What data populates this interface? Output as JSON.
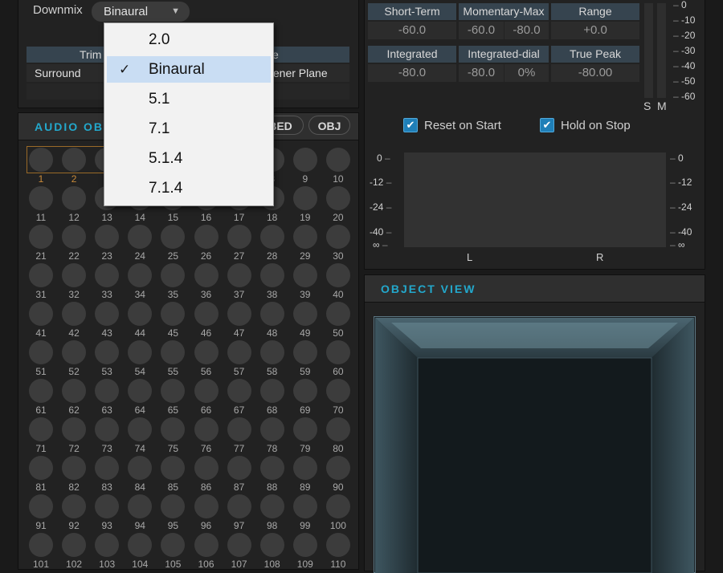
{
  "downmix": {
    "label": "Downmix",
    "selected": "Binaural",
    "options": [
      {
        "label": "2.0",
        "selected": false
      },
      {
        "label": "Binaural",
        "selected": true
      },
      {
        "label": "5.1",
        "selected": false
      },
      {
        "label": "7.1",
        "selected": false
      },
      {
        "label": "5.1.4",
        "selected": false
      },
      {
        "label": "7.1.4",
        "selected": false
      }
    ]
  },
  "trim": {
    "header_left": "Trim",
    "header_right": "e",
    "row_left": "Surround",
    "row_right": "stener Plane"
  },
  "loudness": {
    "headers_row1": [
      "Short-Term",
      "Momentary-Max",
      "Range"
    ],
    "values_row1": [
      "-60.0",
      "-60.0",
      "-80.0",
      "+0.0"
    ],
    "headers_row2": [
      "Integrated",
      "Integrated-dial",
      "True Peak"
    ],
    "values_row2": [
      "-80.0",
      "-80.0",
      "0%",
      "-80.00"
    ],
    "vertical_scale": [
      "0",
      "-10",
      "-20",
      "-30",
      "-40",
      "-50",
      "-60"
    ],
    "sm_labels": [
      "S",
      "M"
    ]
  },
  "options": {
    "reset_on_start": "Reset on Start",
    "hold_on_stop": "Hold on Stop"
  },
  "level_meter": {
    "scale": [
      "0",
      "-12",
      "-24",
      "-40",
      "∞"
    ],
    "channels": [
      "L",
      "R"
    ]
  },
  "audio_objects": {
    "title": "AUDIO OB",
    "bed_button": "BED",
    "obj_button": "OBJ"
  },
  "object_view": {
    "title": "OBJECT VIEW"
  },
  "colors": {
    "accent": "#23a8cc",
    "header_cell": "#36444f",
    "active_object": "#c88a3a",
    "checkbox": "#1f7fb8"
  }
}
